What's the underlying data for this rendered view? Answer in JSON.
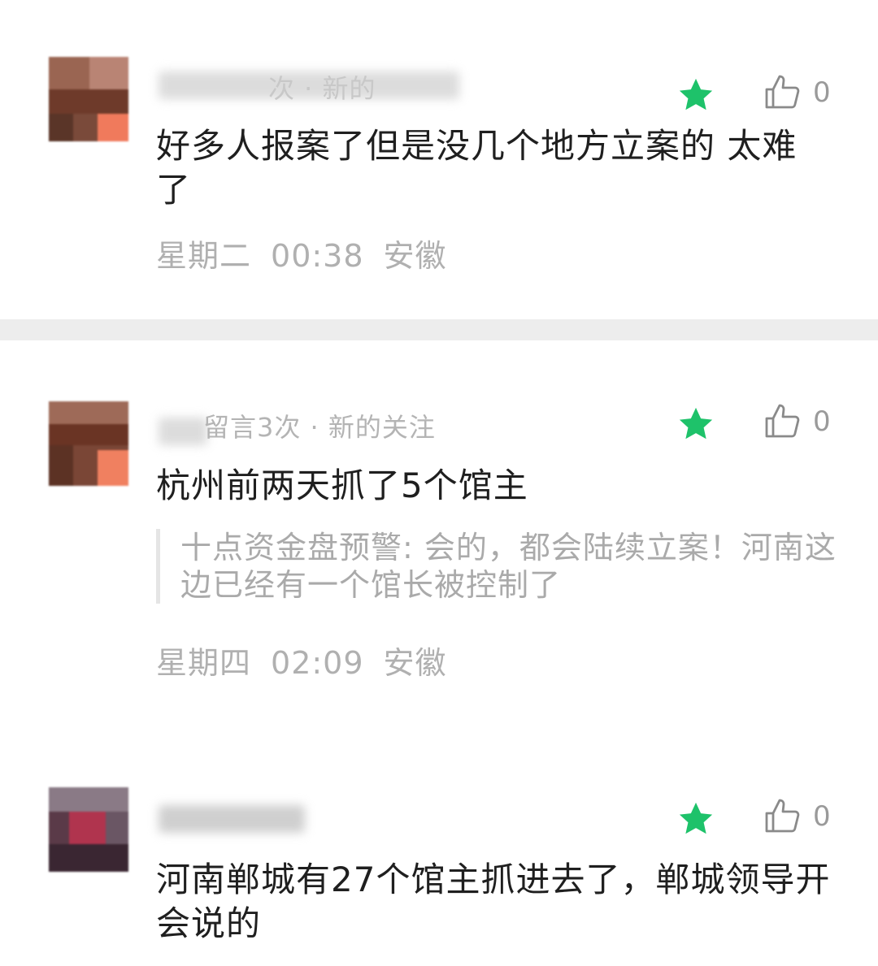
{
  "colors": {
    "star": "#1ec26a",
    "text": "#1f1f1f",
    "meta": "#b4b4b4",
    "divider": "#ededed"
  },
  "comments": [
    {
      "meta": "次 · 新的",
      "likes": "0",
      "content": "好多人报案了但是没几个地方立案的 太难了",
      "reply_author": "",
      "reply_text": "",
      "day": "星期二",
      "time": "00:38",
      "location": "安徽"
    },
    {
      "meta": "留言3次 · 新的关注",
      "likes": "0",
      "content": "杭州前两天抓了5个馆主",
      "reply_author": "十点资金盘预警",
      "reply_text": "十点资金盘预警: 会的，都会陆续立案！河南这边已经有一个馆长被控制了",
      "day": "星期四",
      "time": "02:09",
      "location": "安徽"
    },
    {
      "meta": "",
      "likes": "0",
      "content": "河南郸城有27个馆主抓进去了，郸城领导开会说的",
      "reply_author": "",
      "reply_text": "",
      "day": "",
      "time": "",
      "location": ""
    }
  ],
  "icons": {
    "star": "star-icon",
    "like": "thumbs-up-icon"
  }
}
